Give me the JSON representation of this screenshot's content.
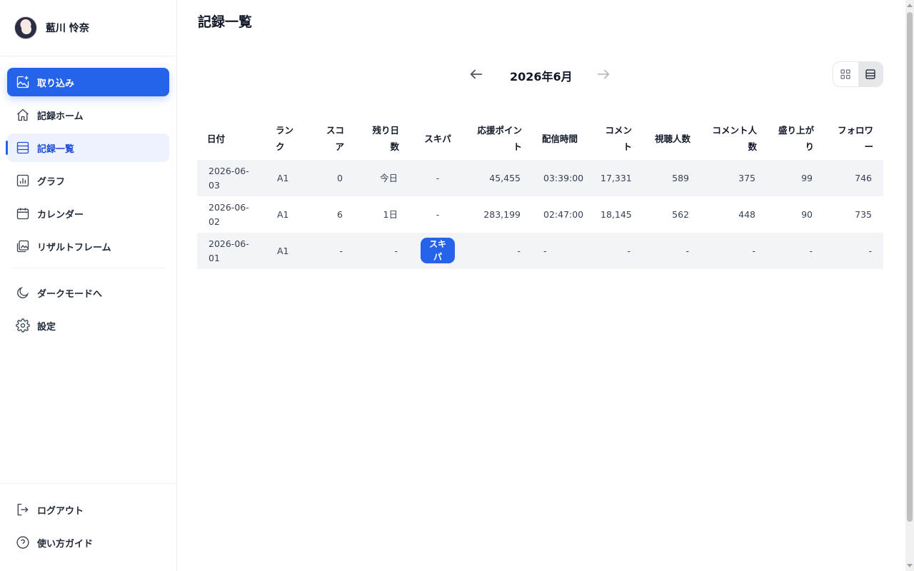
{
  "profile": {
    "name": "藍川 怜奈"
  },
  "nav": {
    "import": "取り込み",
    "home": "記録ホーム",
    "list": "記録一覧",
    "graph": "グラフ",
    "calendar": "カレンダー",
    "result_frame": "リザルトフレーム",
    "dark_mode": "ダークモードへ",
    "settings": "設定",
    "logout": "ログアウト",
    "guide": "使い方ガイド"
  },
  "page": {
    "title": "記録一覧"
  },
  "month_nav": {
    "label": "2026年6月"
  },
  "table": {
    "headers": {
      "date": "日付",
      "rank": "ランク",
      "score": "スコア",
      "days_left": "残り日数",
      "skip": "スキパ",
      "support_points": "応援ポイント",
      "stream_time": "配信時間",
      "comments": "コメント",
      "viewers": "視聴人数",
      "commenters": "コメント人数",
      "excitement": "盛り上がり",
      "followers": "フォロワー"
    },
    "rows": [
      {
        "date": "2026-06-03",
        "rank": "A1",
        "score": "0",
        "days_left": "今日",
        "skip": "-",
        "support_points": "45,455",
        "stream_time": "03:39:00",
        "comments": "17,331",
        "viewers": "589",
        "commenters": "375",
        "excitement": "99",
        "followers": "746"
      },
      {
        "date": "2026-06-02",
        "rank": "A1",
        "score": "6",
        "days_left": "1日",
        "skip": "-",
        "support_points": "283,199",
        "stream_time": "02:47:00",
        "comments": "18,145",
        "viewers": "562",
        "commenters": "448",
        "excitement": "90",
        "followers": "735"
      },
      {
        "date": "2026-06-01",
        "rank": "A1",
        "score": "-",
        "days_left": "-",
        "skip": "スキパ",
        "support_points": "-",
        "stream_time": "-",
        "comments": "-",
        "viewers": "-",
        "commenters": "-",
        "excitement": "-",
        "followers": "-"
      }
    ]
  },
  "icons": {
    "import": "image-plus-icon",
    "home": "home-icon",
    "list": "list-icon",
    "graph": "bar-chart-icon",
    "calendar": "calendar-icon",
    "result_frame": "image-gallery-icon",
    "dark_mode": "moon-icon",
    "settings": "gear-icon",
    "logout": "logout-icon",
    "guide": "help-circle-icon",
    "prev": "arrow-left-icon",
    "next": "arrow-right-icon",
    "grid_view": "grid-view-icon",
    "list_view": "list-view-icon"
  },
  "colors": {
    "accent": "#2563eb",
    "active_bg": "#eef2ff",
    "row_shade": "#f3f4f8"
  }
}
